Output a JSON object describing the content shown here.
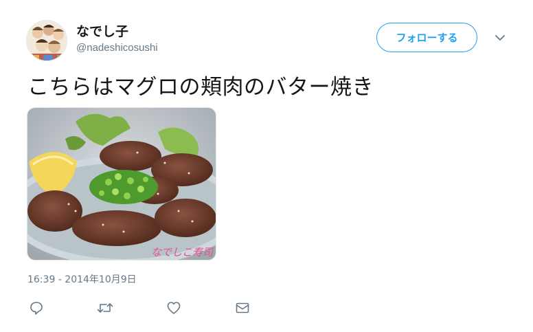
{
  "user": {
    "display_name": "なでし子",
    "screen_name": "@nadeshicosushi"
  },
  "follow_button": {
    "label": "フォローする"
  },
  "tweet": {
    "text": "こちらはマグロの頬肉のバター焼き",
    "timestamp": "16:39 - 2014年10月9日",
    "image_watermark": "なでしこ寿司"
  },
  "actions": {
    "icons": [
      "reply-icon",
      "retweet-icon",
      "like-icon",
      "direct-message-icon"
    ]
  },
  "colors": {
    "accent": "#1da1f2",
    "secondary_text": "#657786",
    "primary_text": "#14171a",
    "icon": "#657786"
  }
}
